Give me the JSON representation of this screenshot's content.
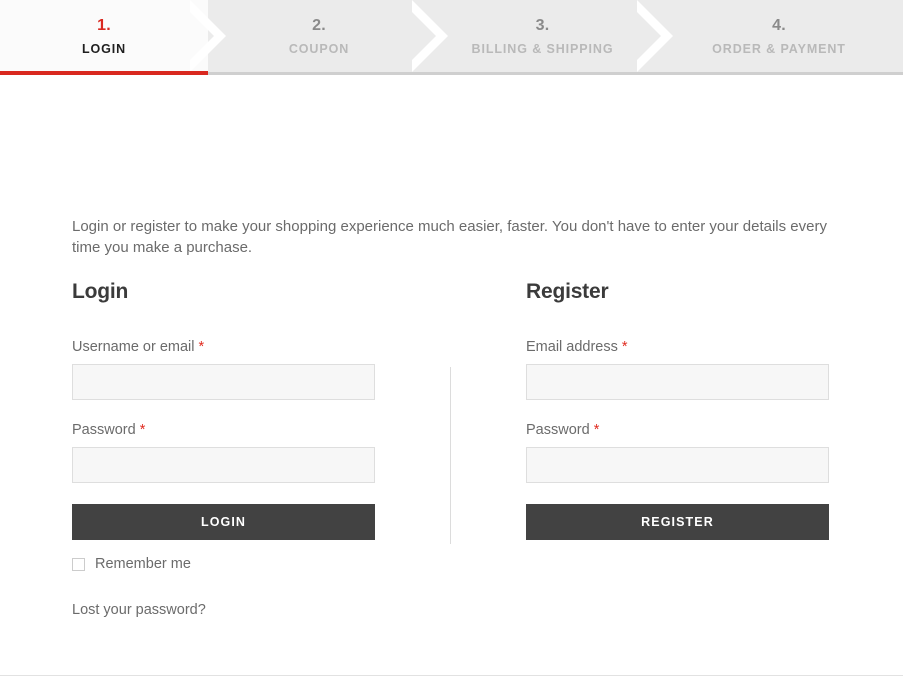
{
  "steps": {
    "items": [
      {
        "number": "1.",
        "label": "LOGIN",
        "state": "active"
      },
      {
        "number": "2.",
        "label": "COUPON",
        "state": "inactive"
      },
      {
        "number": "3.",
        "label": "BILLING & SHIPPING",
        "state": "inactive"
      },
      {
        "number": "4.",
        "label": "ORDER & PAYMENT",
        "state": "inactive"
      }
    ],
    "active_color": "#d9281f",
    "inactive_bg": "#ebebeb",
    "active_bg": "#fbfbfb"
  },
  "intro": {
    "text": "Login or register to make your shopping experience much easier, faster. You don't have to enter your details every time you make a purchase."
  },
  "login": {
    "title": "Login",
    "username_label": "Username or email",
    "username_required": "*",
    "username_value": "",
    "username_placeholder": "",
    "password_label": "Password",
    "password_required": "*",
    "password_value": "",
    "password_placeholder": "",
    "submit_label": "LOGIN",
    "remember_label": "Remember me",
    "remember_checked": false,
    "lost_password_label": "Lost your password?"
  },
  "register": {
    "title": "Register",
    "email_label": "Email address",
    "email_required": "*",
    "email_value": "",
    "email_placeholder": "",
    "password_label": "Password",
    "password_required": "*",
    "password_value": "",
    "password_placeholder": "",
    "submit_label": "REGISTER"
  },
  "theme": {
    "accent": "#d9281f",
    "button_bg": "#424242",
    "input_bg": "#f7f7f7",
    "input_border": "#dedede",
    "text": "#6b6b6b",
    "heading": "#3b3b3b"
  }
}
